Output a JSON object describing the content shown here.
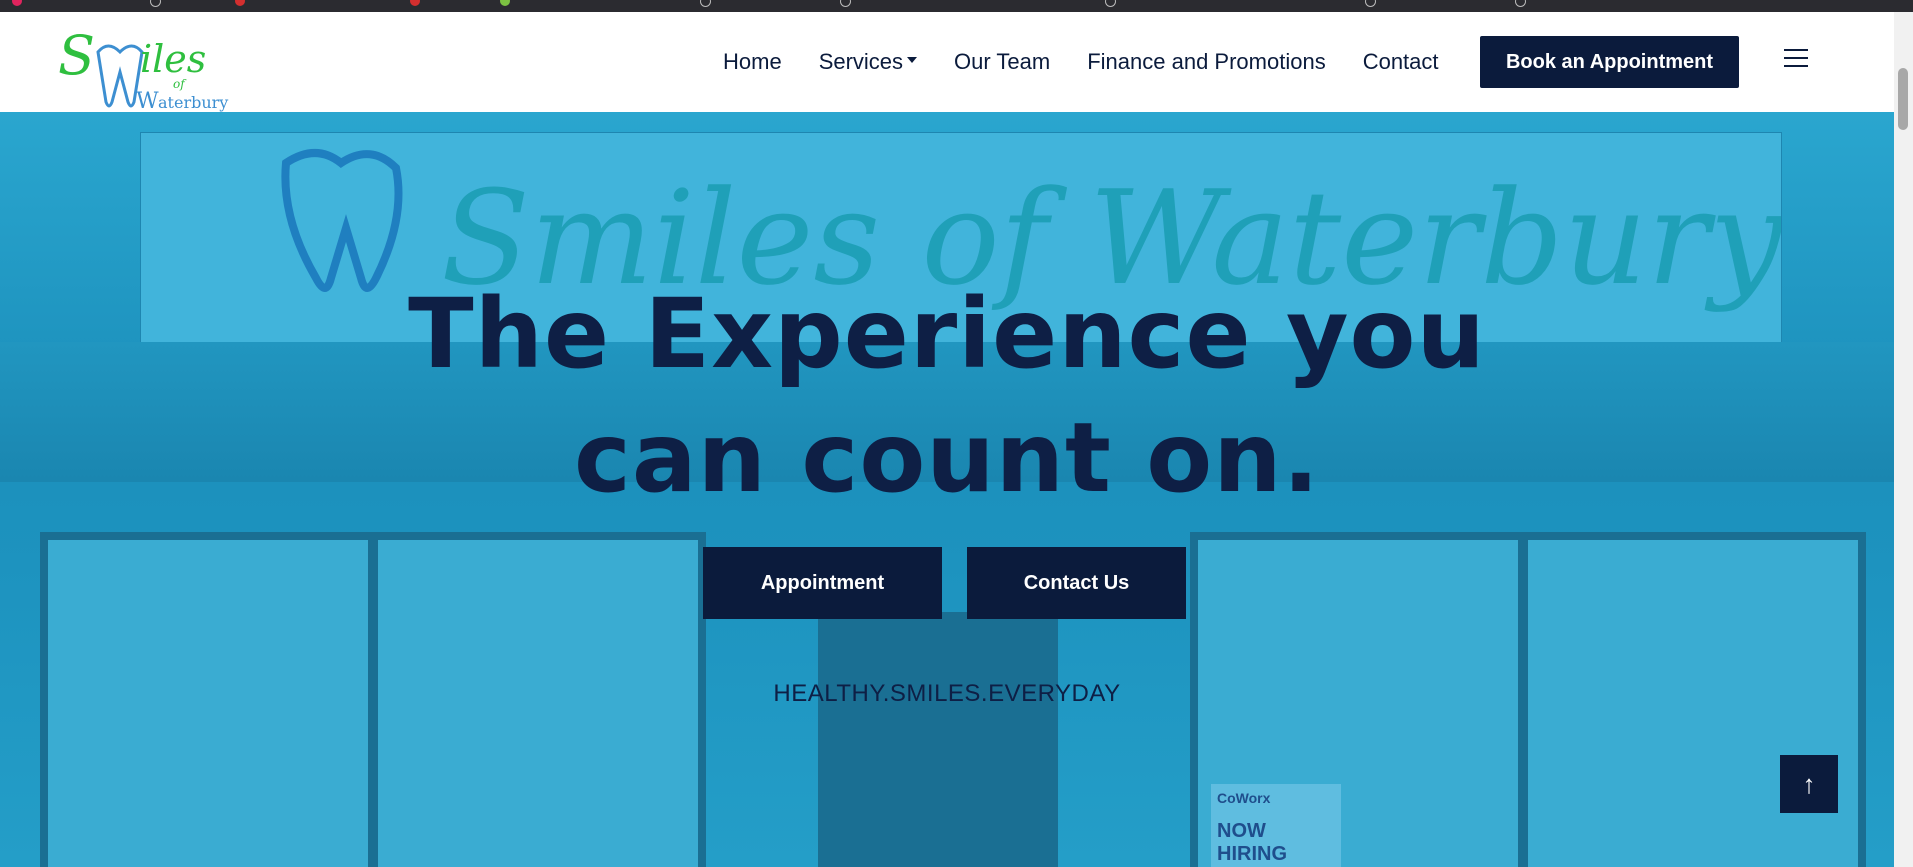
{
  "header": {
    "logo_text": "Smiles of Waterbury",
    "nav": [
      {
        "label": "Home"
      },
      {
        "label": "Services"
      },
      {
        "label": "Our Team"
      },
      {
        "label": "Finance and Promotions"
      },
      {
        "label": "Contact"
      }
    ],
    "book_button": "Book an Appointment",
    "menu_icon": "hamburger-icon"
  },
  "hero": {
    "sign_text": "Smiles of Waterbury",
    "headline_line1": "The Experience you",
    "headline_line2": "can count on.",
    "buttons": [
      {
        "label": "Appointment"
      },
      {
        "label": "Contact Us"
      }
    ],
    "tagline": "HEALTHY.SMILES.EVERYDAY",
    "poster_brand": "CoWorx",
    "poster_text": "NOW HIRING"
  },
  "colors": {
    "navy": "#0b1b3c",
    "hero_blue": "#2aa6cf",
    "logo_green": "#2fbf3f",
    "logo_blue": "#3d8fd1"
  },
  "back_to_top_icon": "arrow-up-icon"
}
